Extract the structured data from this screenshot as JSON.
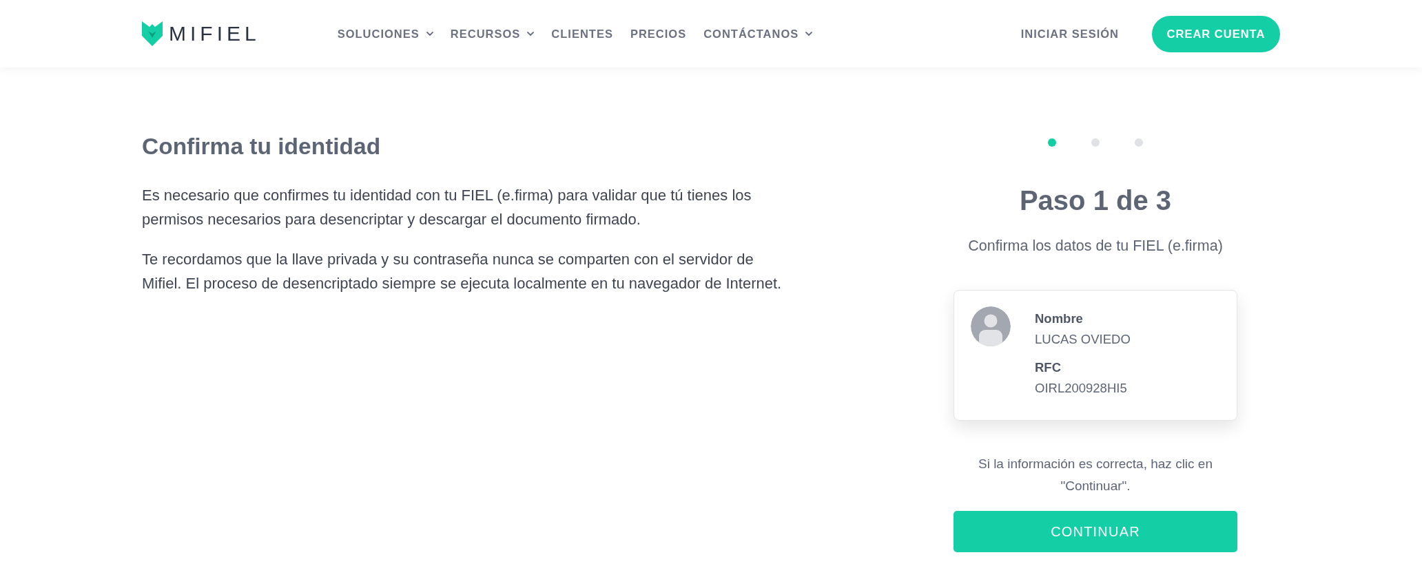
{
  "header": {
    "logo": {
      "text": "MIFIEL"
    },
    "nav": [
      {
        "label": "SOLUCIONES",
        "dropdown": true
      },
      {
        "label": "RECURSOS",
        "dropdown": true
      },
      {
        "label": "CLIENTES",
        "dropdown": false
      },
      {
        "label": "PRECIOS",
        "dropdown": false
      },
      {
        "label": "CONTÁCTANOS",
        "dropdown": true
      }
    ],
    "login": "INICIAR SESIÓN",
    "signup": "CREAR CUENTA"
  },
  "intro": {
    "title": "Confirma tu identidad",
    "paragraphs": [
      "Es necesario que confirmes tu identidad con tu FIEL (e.firma) para validar que tú tienes los permisos necesarios para desencriptar y descargar el documento firmado.",
      "Te recordamos que la llave privada y su contraseña nunca se comparten con el servidor de Mifiel. El proceso de desencriptado siempre se ejecuta localmente en tu navegador de Internet."
    ]
  },
  "wizard": {
    "steps": [
      {
        "selected": true
      },
      {
        "selected": false
      },
      {
        "selected": false
      }
    ],
    "title": "Paso 1 de 3",
    "subtitle": "Confirma los datos de tu FIEL (e.firma)",
    "card": {
      "fields": [
        {
          "label": "Nombre",
          "value": "LUCAS OVIEDO"
        },
        {
          "label": "RFC",
          "value": "OIRL200928HI5"
        }
      ]
    },
    "note": "Si la información es correcta, haz clic en \"Continuar\".",
    "button": "CONTINUAR"
  }
}
